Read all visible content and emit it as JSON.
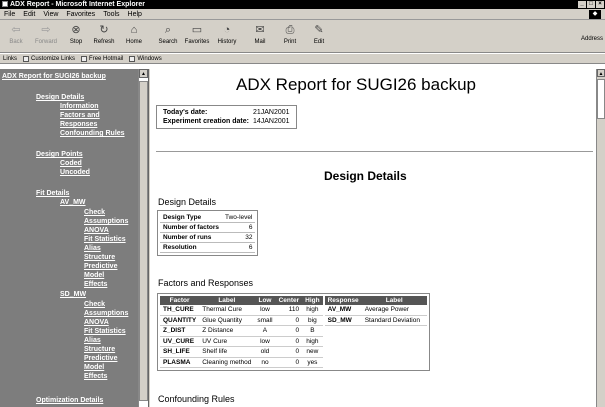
{
  "window": {
    "title": "ADX Report - Microsoft Internet Explorer"
  },
  "menu": [
    "File",
    "Edit",
    "View",
    "Favorites",
    "Tools",
    "Help"
  ],
  "toolbar": {
    "back": "Back",
    "forward": "Forward",
    "stop": "Stop",
    "refresh": "Refresh",
    "home": "Home",
    "search": "Search",
    "favorites": "Favorites",
    "history": "History",
    "mail": "Mail",
    "print": "Print",
    "edit": "Edit",
    "address": "Address"
  },
  "links": {
    "label": "Links",
    "items": [
      "Customize Links",
      "Free Hotmail",
      "Windows"
    ]
  },
  "nav": {
    "title": "ADX Report for SUGI26 backup",
    "design_details": "Design Details",
    "information": "Information",
    "factors_responses_1": "Factors and",
    "factors_responses_2": "Responses",
    "confounding_rules": "Confounding Rules",
    "design_points": "Design Points",
    "coded": "Coded",
    "uncoded": "Uncoded",
    "fit_details": "Fit Details",
    "av_mw": "AV_MW",
    "sd_mw": "SD_MW",
    "check": "Check",
    "assumptions": "Assumptions",
    "anova": "ANOVA",
    "fit_statistics": "Fit Statistics",
    "alias": "Alias",
    "structure": "Structure",
    "predictive": "Predictive",
    "model": "Model",
    "effects": "Effects",
    "optimization_details": "Optimization Details"
  },
  "main": {
    "report_title": "ADX Report for SUGI26 backup",
    "todays_date_label": "Today's date:",
    "todays_date": "21JAN2001",
    "exp_date_label": "Experiment creation date:",
    "exp_date": "14JAN2001",
    "section_title": "Design Details",
    "design_details_heading": "Design Details",
    "design_details": [
      {
        "k": "Design Type",
        "v": "Two-level"
      },
      {
        "k": "Number of factors",
        "v": "6"
      },
      {
        "k": "Number of runs",
        "v": "32"
      },
      {
        "k": "Resolution",
        "v": "6"
      }
    ],
    "factors_heading": "Factors and Responses",
    "factor_headers": [
      "Factor",
      "Label",
      "Low",
      "Center",
      "High"
    ],
    "factors": [
      [
        "TH_CURE",
        "Thermal Cure",
        "low",
        "110",
        "high"
      ],
      [
        "QUANTITY",
        "Glue Quantity",
        "small",
        "0",
        "big"
      ],
      [
        "Z_DIST",
        "Z Distance",
        "A",
        "0",
        "B"
      ],
      [
        "UV_CURE",
        "UV Cure",
        "low",
        "0",
        "high"
      ],
      [
        "SH_LIFE",
        "Shelf life",
        "old",
        "0",
        "new"
      ],
      [
        "PLASMA",
        "Cleaning method",
        "no",
        "0",
        "yes"
      ]
    ],
    "response_headers": [
      "Response",
      "Label"
    ],
    "responses": [
      [
        "AV_MW",
        "Average Power"
      ],
      [
        "SD_MW",
        "Standard Deviation"
      ]
    ],
    "confounding_heading": "Confounding Rules"
  }
}
